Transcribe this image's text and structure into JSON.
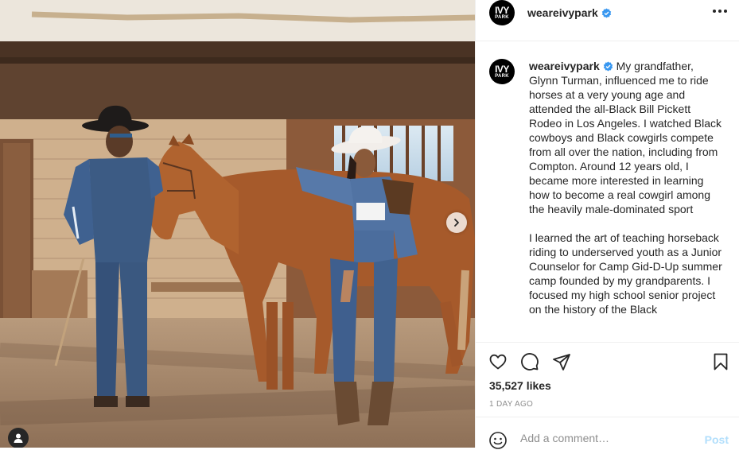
{
  "post": {
    "username": "weareivypark",
    "avatar_text_main": "IVY",
    "avatar_text_sub": "PARK",
    "caption": {
      "paragraph1": "My grandfather, Glynn Turman, influenced me to ride horses at a very young age and attended the all-Black Bill Pickett Rodeo in Los Angeles. I watched Black cowboys and Black cowgirls compete from all over the nation, including from Compton. Around 12 years old, I became more interested in learning how to become a real cowgirl among the heavily male-dominated sport",
      "paragraph2": "I learned the art of teaching horseback riding to underserved youth as a Junior Counselor for Camp Gid-D-Up summer camp founded by my grandparents. I focused my high school senior project on the history of the Black"
    },
    "likes": "35,527 likes",
    "time_ago": "1 DAY AGO"
  },
  "comment": {
    "placeholder": "Add a comment…",
    "post_label": "Post"
  },
  "icons": {
    "more": "more-options-icon",
    "like": "heart-icon",
    "comment": "comment-icon",
    "share": "paper-plane-icon",
    "save": "bookmark-icon",
    "emoji": "emoji-icon",
    "verified": "verified-badge-icon",
    "next": "chevron-right-icon",
    "tag": "user-tag-icon"
  },
  "colors": {
    "verified": "#3897f0",
    "post_disabled": "#b2dffc",
    "secondary_text": "#8e8e8e",
    "text": "#262626"
  }
}
